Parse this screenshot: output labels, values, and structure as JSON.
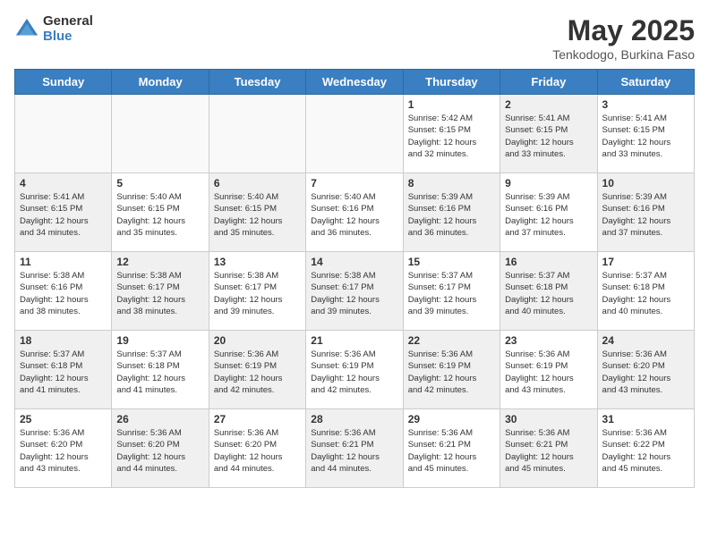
{
  "header": {
    "logo_general": "General",
    "logo_blue": "Blue",
    "month_title": "May 2025",
    "location": "Tenkodogo, Burkina Faso"
  },
  "weekdays": [
    "Sunday",
    "Monday",
    "Tuesday",
    "Wednesday",
    "Thursday",
    "Friday",
    "Saturday"
  ],
  "weeks": [
    [
      {
        "day": "",
        "info": "",
        "shaded": false,
        "empty": true
      },
      {
        "day": "",
        "info": "",
        "shaded": false,
        "empty": true
      },
      {
        "day": "",
        "info": "",
        "shaded": false,
        "empty": true
      },
      {
        "day": "",
        "info": "",
        "shaded": false,
        "empty": true
      },
      {
        "day": "1",
        "info": "Sunrise: 5:42 AM\nSunset: 6:15 PM\nDaylight: 12 hours\nand 32 minutes.",
        "shaded": false,
        "empty": false
      },
      {
        "day": "2",
        "info": "Sunrise: 5:41 AM\nSunset: 6:15 PM\nDaylight: 12 hours\nand 33 minutes.",
        "shaded": true,
        "empty": false
      },
      {
        "day": "3",
        "info": "Sunrise: 5:41 AM\nSunset: 6:15 PM\nDaylight: 12 hours\nand 33 minutes.",
        "shaded": false,
        "empty": false
      }
    ],
    [
      {
        "day": "4",
        "info": "Sunrise: 5:41 AM\nSunset: 6:15 PM\nDaylight: 12 hours\nand 34 minutes.",
        "shaded": true,
        "empty": false
      },
      {
        "day": "5",
        "info": "Sunrise: 5:40 AM\nSunset: 6:15 PM\nDaylight: 12 hours\nand 35 minutes.",
        "shaded": false,
        "empty": false
      },
      {
        "day": "6",
        "info": "Sunrise: 5:40 AM\nSunset: 6:15 PM\nDaylight: 12 hours\nand 35 minutes.",
        "shaded": true,
        "empty": false
      },
      {
        "day": "7",
        "info": "Sunrise: 5:40 AM\nSunset: 6:16 PM\nDaylight: 12 hours\nand 36 minutes.",
        "shaded": false,
        "empty": false
      },
      {
        "day": "8",
        "info": "Sunrise: 5:39 AM\nSunset: 6:16 PM\nDaylight: 12 hours\nand 36 minutes.",
        "shaded": true,
        "empty": false
      },
      {
        "day": "9",
        "info": "Sunrise: 5:39 AM\nSunset: 6:16 PM\nDaylight: 12 hours\nand 37 minutes.",
        "shaded": false,
        "empty": false
      },
      {
        "day": "10",
        "info": "Sunrise: 5:39 AM\nSunset: 6:16 PM\nDaylight: 12 hours\nand 37 minutes.",
        "shaded": true,
        "empty": false
      }
    ],
    [
      {
        "day": "11",
        "info": "Sunrise: 5:38 AM\nSunset: 6:16 PM\nDaylight: 12 hours\nand 38 minutes.",
        "shaded": false,
        "empty": false
      },
      {
        "day": "12",
        "info": "Sunrise: 5:38 AM\nSunset: 6:17 PM\nDaylight: 12 hours\nand 38 minutes.",
        "shaded": true,
        "empty": false
      },
      {
        "day": "13",
        "info": "Sunrise: 5:38 AM\nSunset: 6:17 PM\nDaylight: 12 hours\nand 39 minutes.",
        "shaded": false,
        "empty": false
      },
      {
        "day": "14",
        "info": "Sunrise: 5:38 AM\nSunset: 6:17 PM\nDaylight: 12 hours\nand 39 minutes.",
        "shaded": true,
        "empty": false
      },
      {
        "day": "15",
        "info": "Sunrise: 5:37 AM\nSunset: 6:17 PM\nDaylight: 12 hours\nand 39 minutes.",
        "shaded": false,
        "empty": false
      },
      {
        "day": "16",
        "info": "Sunrise: 5:37 AM\nSunset: 6:18 PM\nDaylight: 12 hours\nand 40 minutes.",
        "shaded": true,
        "empty": false
      },
      {
        "day": "17",
        "info": "Sunrise: 5:37 AM\nSunset: 6:18 PM\nDaylight: 12 hours\nand 40 minutes.",
        "shaded": false,
        "empty": false
      }
    ],
    [
      {
        "day": "18",
        "info": "Sunrise: 5:37 AM\nSunset: 6:18 PM\nDaylight: 12 hours\nand 41 minutes.",
        "shaded": true,
        "empty": false
      },
      {
        "day": "19",
        "info": "Sunrise: 5:37 AM\nSunset: 6:18 PM\nDaylight: 12 hours\nand 41 minutes.",
        "shaded": false,
        "empty": false
      },
      {
        "day": "20",
        "info": "Sunrise: 5:36 AM\nSunset: 6:19 PM\nDaylight: 12 hours\nand 42 minutes.",
        "shaded": true,
        "empty": false
      },
      {
        "day": "21",
        "info": "Sunrise: 5:36 AM\nSunset: 6:19 PM\nDaylight: 12 hours\nand 42 minutes.",
        "shaded": false,
        "empty": false
      },
      {
        "day": "22",
        "info": "Sunrise: 5:36 AM\nSunset: 6:19 PM\nDaylight: 12 hours\nand 42 minutes.",
        "shaded": true,
        "empty": false
      },
      {
        "day": "23",
        "info": "Sunrise: 5:36 AM\nSunset: 6:19 PM\nDaylight: 12 hours\nand 43 minutes.",
        "shaded": false,
        "empty": false
      },
      {
        "day": "24",
        "info": "Sunrise: 5:36 AM\nSunset: 6:20 PM\nDaylight: 12 hours\nand 43 minutes.",
        "shaded": true,
        "empty": false
      }
    ],
    [
      {
        "day": "25",
        "info": "Sunrise: 5:36 AM\nSunset: 6:20 PM\nDaylight: 12 hours\nand 43 minutes.",
        "shaded": false,
        "empty": false
      },
      {
        "day": "26",
        "info": "Sunrise: 5:36 AM\nSunset: 6:20 PM\nDaylight: 12 hours\nand 44 minutes.",
        "shaded": true,
        "empty": false
      },
      {
        "day": "27",
        "info": "Sunrise: 5:36 AM\nSunset: 6:20 PM\nDaylight: 12 hours\nand 44 minutes.",
        "shaded": false,
        "empty": false
      },
      {
        "day": "28",
        "info": "Sunrise: 5:36 AM\nSunset: 6:21 PM\nDaylight: 12 hours\nand 44 minutes.",
        "shaded": true,
        "empty": false
      },
      {
        "day": "29",
        "info": "Sunrise: 5:36 AM\nSunset: 6:21 PM\nDaylight: 12 hours\nand 45 minutes.",
        "shaded": false,
        "empty": false
      },
      {
        "day": "30",
        "info": "Sunrise: 5:36 AM\nSunset: 6:21 PM\nDaylight: 12 hours\nand 45 minutes.",
        "shaded": true,
        "empty": false
      },
      {
        "day": "31",
        "info": "Sunrise: 5:36 AM\nSunset: 6:22 PM\nDaylight: 12 hours\nand 45 minutes.",
        "shaded": false,
        "empty": false
      }
    ]
  ]
}
